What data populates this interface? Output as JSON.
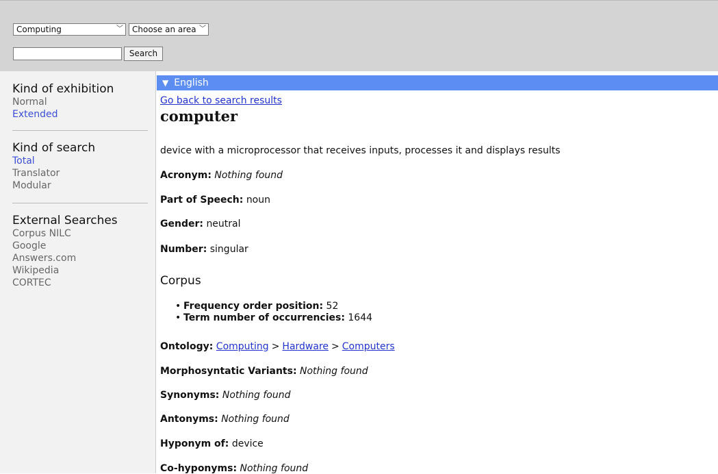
{
  "header": {
    "area_select_value": "Computing",
    "subarea_select_value": "Choose an area",
    "search_placeholder": "",
    "search_button_label": "Search"
  },
  "sidebar": {
    "exhibition": {
      "title": "Kind of exhibition",
      "items": [
        {
          "label": "Normal",
          "active": false
        },
        {
          "label": "Extended",
          "active": true
        }
      ]
    },
    "search_kind": {
      "title": "Kind of search",
      "items": [
        {
          "label": "Total",
          "active": true
        },
        {
          "label": "Translator",
          "active": false
        },
        {
          "label": "Modular",
          "active": false
        }
      ]
    },
    "external": {
      "title": "External Searches",
      "items": [
        {
          "label": "Corpus NILC"
        },
        {
          "label": "Google"
        },
        {
          "label": "Answers.com"
        },
        {
          "label": "Wikipedia"
        },
        {
          "label": "CORTEC"
        }
      ]
    }
  },
  "main": {
    "language_bar": "English",
    "back_link": "Go back to search results",
    "term": "computer",
    "definition": "device with a microprocessor that receives inputs, processes it and displays results",
    "fields": {
      "acronym_label": "Acronym:",
      "acronym_value": "Nothing found",
      "pos_label": "Part of Speech:",
      "pos_value": "noun",
      "gender_label": "Gender:",
      "gender_value": "neutral",
      "number_label": "Number:",
      "number_value": "singular"
    },
    "corpus": {
      "title": "Corpus",
      "freq_label": "Frequency order position:",
      "freq_value": "52",
      "occ_label": "Term number of occurrencies:",
      "occ_value": "1644"
    },
    "ontology": {
      "label": "Ontology:",
      "path": [
        "Computing",
        "Hardware",
        "Computers"
      ],
      "separator": ">"
    },
    "morph_label": "Morphosyntatic Variants:",
    "morph_value": "Nothing found",
    "synonyms_label": "Synonyms:",
    "synonyms_value": "Nothing found",
    "antonyms_label": "Antonyms:",
    "antonyms_value": "Nothing found",
    "hyponym_label": "Hyponym of:",
    "hyponym_value": "device",
    "cohyponyms_label": "Co-hyponyms:",
    "cohyponyms_value": "Nothing found"
  },
  "colors": {
    "header_bg": "#d4d4d4",
    "sidebar_bg": "#f2f2f2",
    "language_bar": "#5b8ef0",
    "link": "#2233cc",
    "active_item": "#3b4fd6"
  }
}
